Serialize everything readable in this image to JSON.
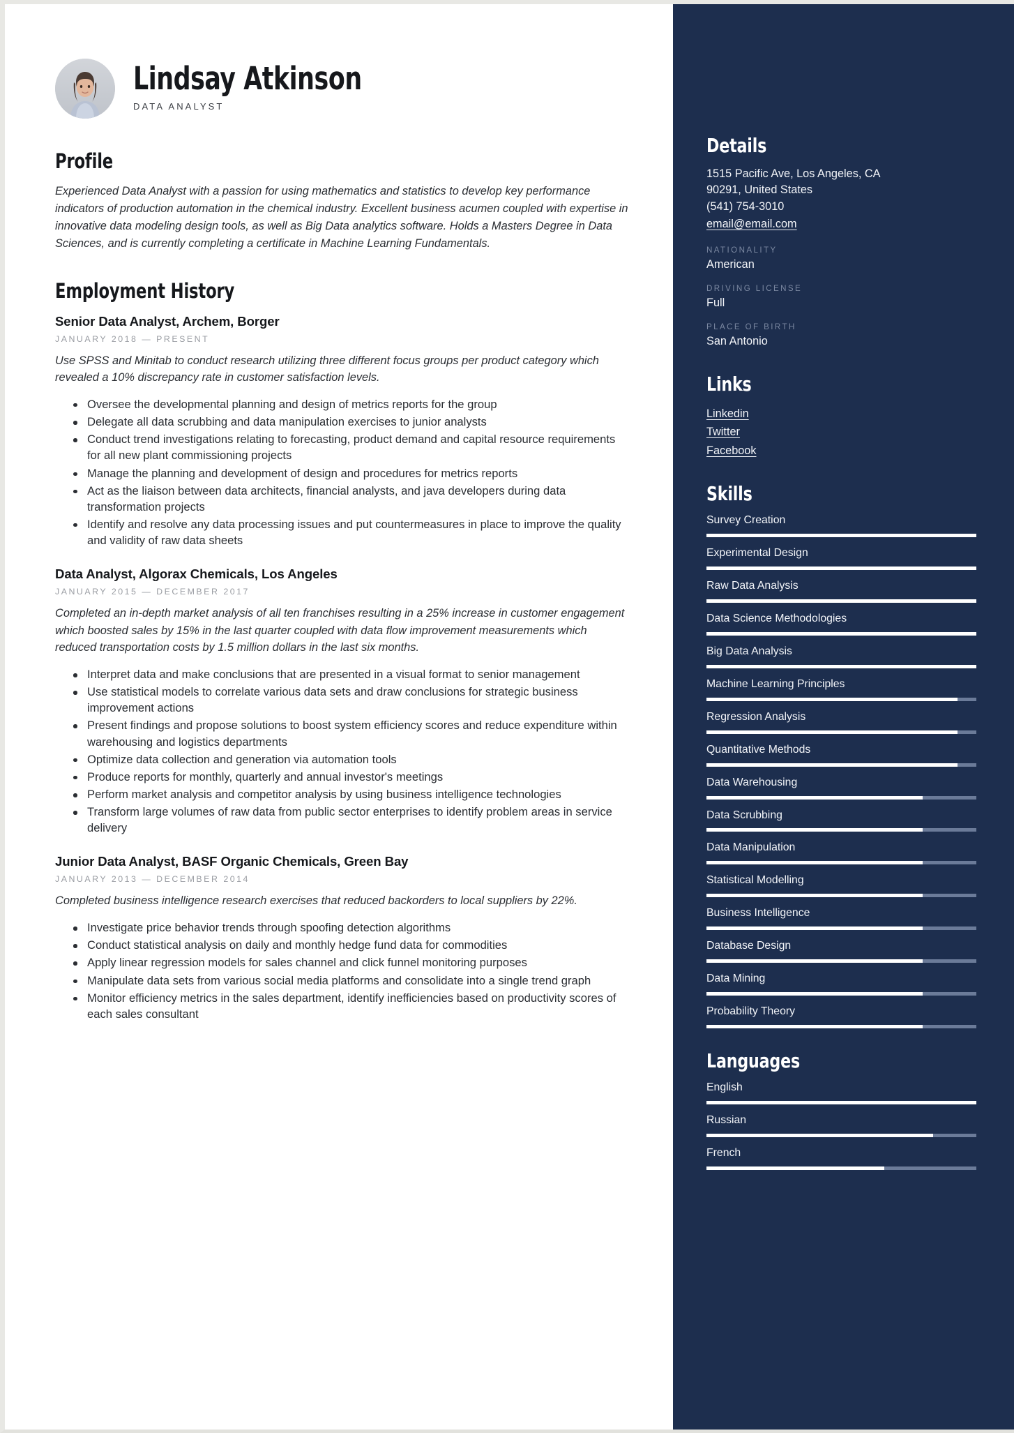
{
  "person": {
    "name": "Lindsay Atkinson",
    "role": "DATA ANALYST",
    "avatar_icon": "profile-photo"
  },
  "profile": {
    "heading": "Profile",
    "text": "Experienced Data Analyst with a passion for using mathematics and statistics to develop key performance indicators of production automation in the chemical industry.  Excellent business acumen coupled with expertise in innovative data modeling design tools, as well as Big Data analytics software.  Holds a Masters Degree in Data Sciences, and is currently completing a certificate in Machine Learning Fundamentals."
  },
  "employment": {
    "heading": "Employment History",
    "jobs": [
      {
        "title": "Senior Data Analyst, Archem, Borger",
        "date": "JANUARY 2018 — PRESENT",
        "summary": "Use SPSS and Minitab to conduct research utilizing three different focus groups per product category which revealed a 10% discrepancy rate in customer satisfaction levels.",
        "duties": [
          "Oversee the developmental planning and design of metrics reports for the group",
          "Delegate all data scrubbing and data manipulation exercises to junior analysts",
          "Conduct trend investigations relating to forecasting, product demand and capital resource requirements for all new plant commissioning projects",
          "Manage the planning and development of design and procedures for metrics reports",
          "Act as the liaison between data architects, financial analysts, and java developers during data transformation projects",
          "Identify and resolve any data processing issues and put countermeasures in place to improve the quality and validity of raw data sheets"
        ]
      },
      {
        "title": "Data Analyst, Algorax Chemicals, Los Angeles",
        "date": "JANUARY 2015 — DECEMBER 2017",
        "summary": "Completed an in-depth market analysis of all ten franchises resulting in a 25% increase in customer engagement which boosted sales by 15% in the last quarter coupled with data flow improvement measurements which reduced transportation costs by 1.5 million dollars in the last six months.",
        "duties": [
          "Interpret data and make conclusions that are presented in a visual format to senior management",
          "Use statistical models to correlate various data sets and draw conclusions for strategic business improvement actions",
          "Present findings and propose solutions to boost system efficiency scores and reduce expenditure within warehousing and logistics departments",
          "Optimize data collection and generation via automation tools",
          "Produce reports for monthly, quarterly and annual investor's meetings",
          "Perform market analysis and competitor analysis by using business intelligence technologies",
          "Transform large volumes of raw data from public sector enterprises to identify problem areas in service delivery"
        ]
      },
      {
        "title": "Junior Data Analyst, BASF Organic Chemicals, Green Bay",
        "date": "JANUARY 2013 — DECEMBER 2014",
        "summary": "Completed business intelligence research exercises that reduced backorders to local suppliers by 22%.",
        "duties": [
          "Investigate price behavior trends through spoofing detection algorithms",
          "Conduct statistical analysis on daily and monthly hedge fund data for commodities",
          "Apply linear regression models for sales channel and click funnel monitoring purposes",
          "Manipulate data sets from various social media platforms and consolidate into a single trend graph",
          "Monitor efficiency metrics in the sales department, identify inefficiencies based on productivity scores of each sales consultant"
        ]
      }
    ]
  },
  "details": {
    "heading": "Details",
    "address_line1": "1515 Pacific Ave, Los Angeles, CA",
    "address_line2": "90291, United States",
    "phone": "(541) 754-3010",
    "email": "email@email.com",
    "fields": [
      {
        "label": "NATIONALITY",
        "value": "American"
      },
      {
        "label": "DRIVING LICENSE",
        "value": "Full"
      },
      {
        "label": "PLACE OF BIRTH",
        "value": "San Antonio"
      }
    ]
  },
  "links": {
    "heading": "Links",
    "items": [
      {
        "label": "Linkedin"
      },
      {
        "label": "Twitter"
      },
      {
        "label": "Facebook"
      }
    ]
  },
  "skills": {
    "heading": "Skills",
    "items": [
      {
        "label": "Survey Creation",
        "level": 100
      },
      {
        "label": "Experimental Design",
        "level": 100
      },
      {
        "label": "Raw Data Analysis",
        "level": 100
      },
      {
        "label": "Data Science Methodologies",
        "level": 100
      },
      {
        "label": "Big Data Analysis",
        "level": 100
      },
      {
        "label": "Machine Learning Principles",
        "level": 93
      },
      {
        "label": "Regression Analysis",
        "level": 93
      },
      {
        "label": "Quantitative Methods",
        "level": 93
      },
      {
        "label": "Data Warehousing",
        "level": 80
      },
      {
        "label": "Data Scrubbing",
        "level": 80
      },
      {
        "label": "Data Manipulation",
        "level": 80
      },
      {
        "label": "Statistical Modelling",
        "level": 80
      },
      {
        "label": "Business Intelligence",
        "level": 80
      },
      {
        "label": "Database Design",
        "level": 80
      },
      {
        "label": "Data Mining",
        "level": 80
      },
      {
        "label": "Probability Theory",
        "level": 80
      }
    ]
  },
  "languages": {
    "heading": "Languages",
    "items": [
      {
        "label": "English",
        "level": 100
      },
      {
        "label": "Russian",
        "level": 84
      },
      {
        "label": "French",
        "level": 66
      }
    ]
  },
  "colors": {
    "sidebar_bg": "#1d2e4e",
    "meter_fill": "#ffffff",
    "meter_track": "#6b7b99",
    "muted_label": "#7b88a1",
    "body_text": "#2b2e33"
  }
}
